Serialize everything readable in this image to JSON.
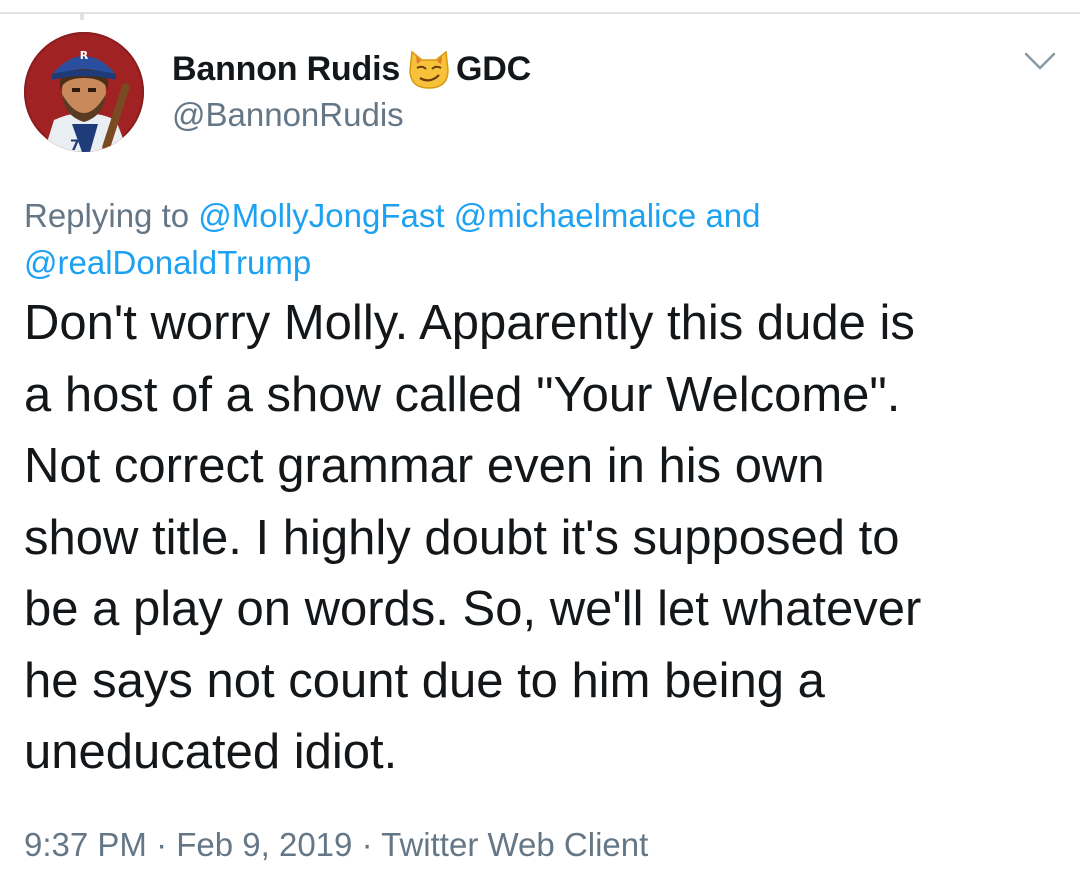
{
  "author": {
    "name": "Bannon Rudis",
    "emoji": "smirking-cat-emoji",
    "name_suffix": "GDC",
    "handle": "@BannonRudis"
  },
  "reply_context": {
    "prefix": "Replying to",
    "mention1": "@MollyJongFast",
    "mention2": "@michaelmalice",
    "conjunction": "and",
    "mention3": "@realDonaldTrump"
  },
  "body_lines": [
    "Don't worry Molly. Apparently this dude is",
    "a host of a show called \"Your Welcome\".",
    "Not correct grammar even in his own",
    "show title. I highly doubt it's supposed to",
    "be a play on words. So, we'll let whatever",
    "he says not count due to him being a",
    "uneducated idiot."
  ],
  "meta": {
    "time": "9:37 PM",
    "sep1": "·",
    "date": "Feb 9, 2019",
    "sep2": "·",
    "client": "Twitter Web Client"
  },
  "colors": {
    "link": "#1da1f2",
    "secondary": "#657786",
    "text": "#14171a"
  }
}
